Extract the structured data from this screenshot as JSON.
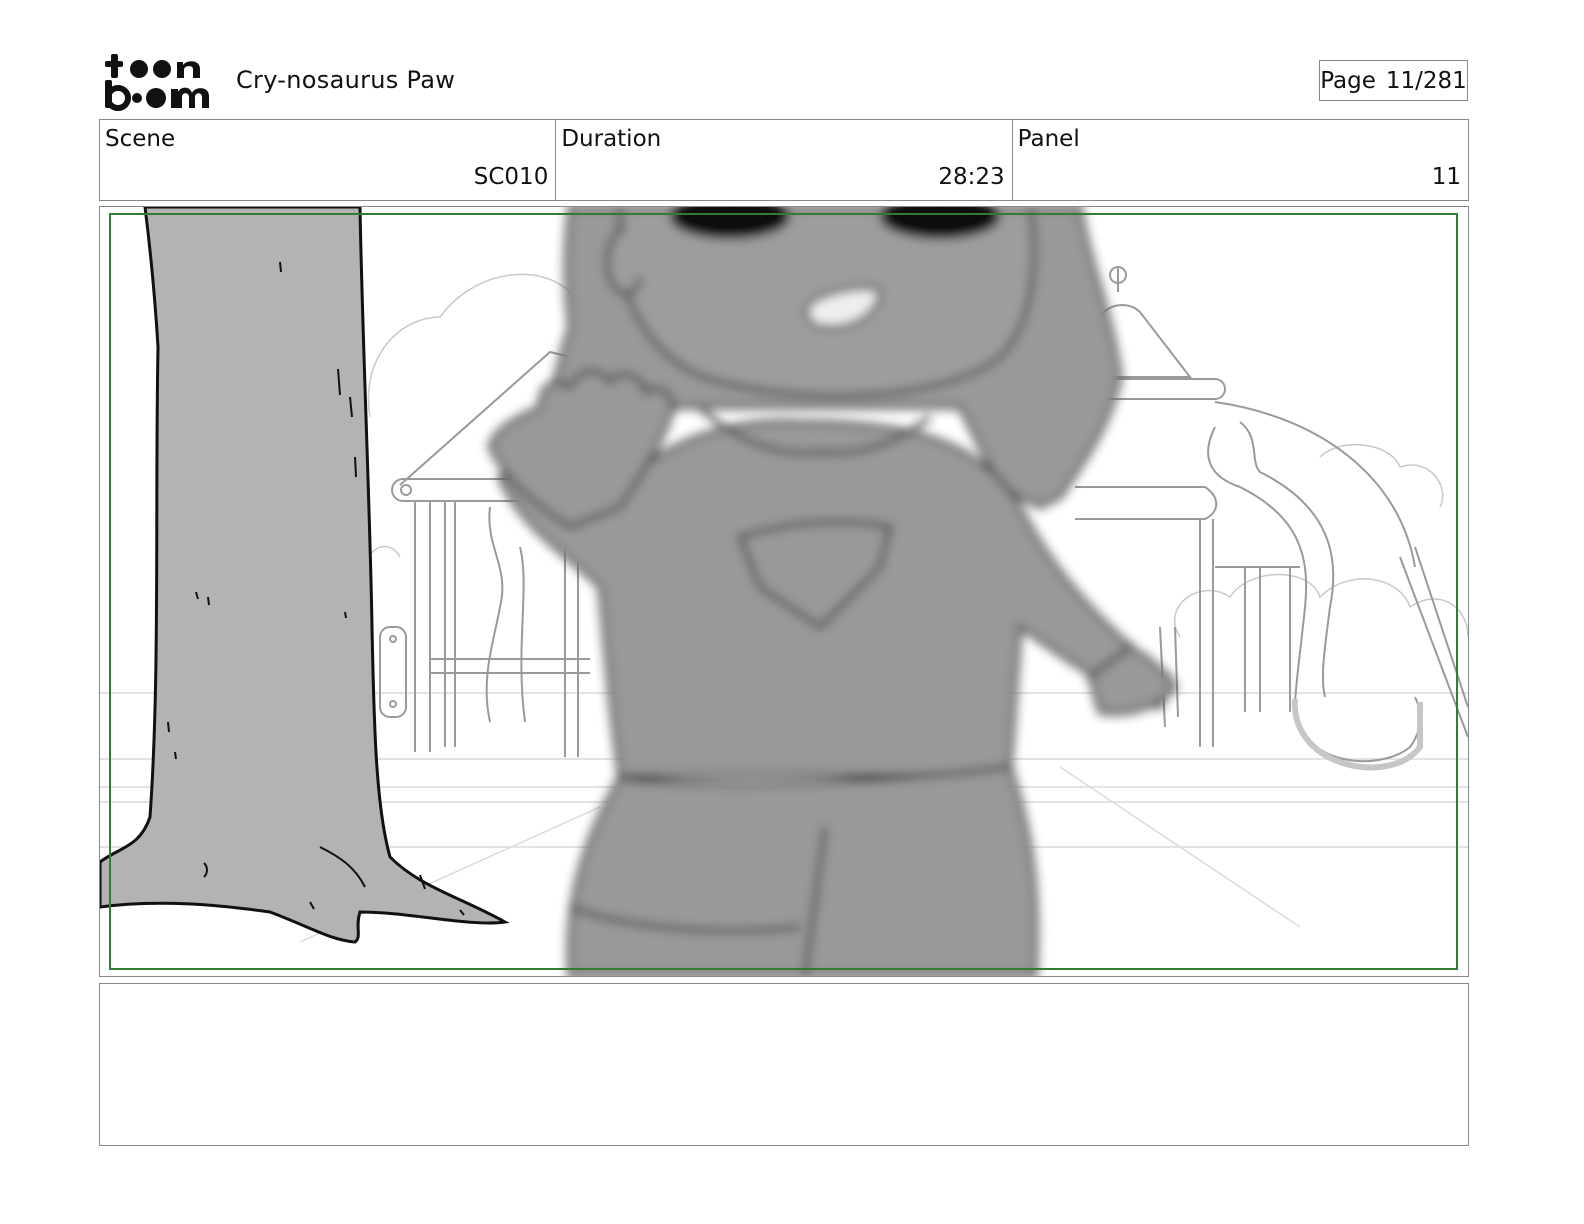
{
  "header": {
    "logo_text": "toon boom",
    "project_title": "Cry-nosaurus Paw",
    "page_label": "Page",
    "page_value": "11/281"
  },
  "info": {
    "scene_label": "Scene",
    "scene_value": "SC010",
    "duration_label": "Duration",
    "duration_value": "28:23",
    "panel_label": "Panel",
    "panel_value": "11"
  },
  "notes": {
    "text": ""
  },
  "colors": {
    "safe_frame": "#2e7d32",
    "border": "#888888",
    "character_fill": "#999999",
    "tree_fill": "#b3b3b3"
  }
}
